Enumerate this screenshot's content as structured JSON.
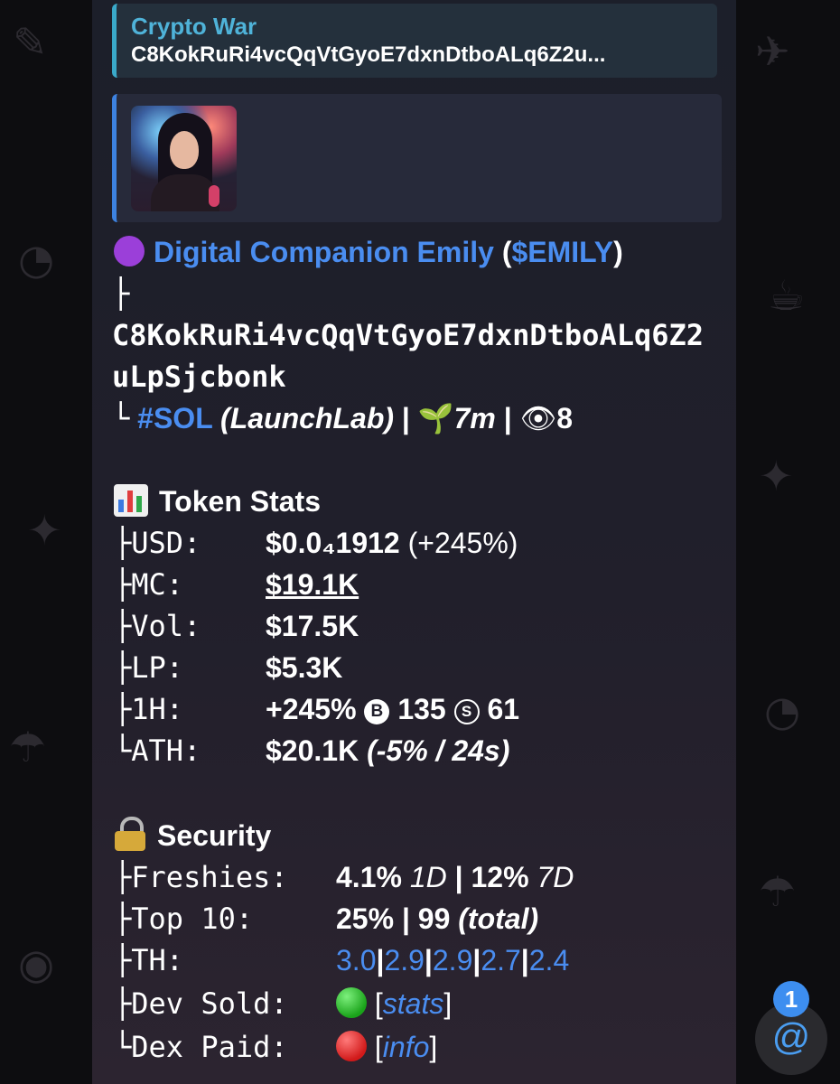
{
  "reply": {
    "title": "Crypto War",
    "text": "C8KokRuRi4vcQqVtGyoE7dxnDtboALq6Z2u..."
  },
  "token": {
    "name": "Digital Companion Emily",
    "ticker_open": "(",
    "ticker": "$EMILY",
    "ticker_close": ")",
    "tree_top": " ├",
    "address_line1": "C8KokRuRi4vcQqVtGyoE7dxnDtboALq6Z2",
    "address_line2": "uLpSjcbonk",
    "tree_bottom": " └",
    "chain": "#SOL",
    "launch": "(LaunchLab)",
    "sep": "|",
    "age_emoji": "🌱",
    "age": "7m",
    "views_emoji": "👁",
    "views": "8"
  },
  "token_stats": {
    "heading": "Token Stats",
    "usd_label": "├USD:",
    "usd_value": "$0.0₄1912",
    "usd_change": "(+245%)",
    "mc_label": "├MC:",
    "mc_value": "$19.1K",
    "vol_label": "├Vol:",
    "vol_value": "$17.5K",
    "lp_label": "├LP:",
    "lp_value": "$5.3K",
    "h1_label": "├1H:",
    "h1_change": "+245%",
    "buys_icon": "B",
    "buys": "135",
    "sells_icon": "S",
    "sells": "61",
    "ath_label": "└ATH:",
    "ath_value": "$20.1K",
    "ath_note": "(-5% / 24s)"
  },
  "security": {
    "heading": "Security",
    "freshies_label": "├Freshies:",
    "freshies_1d": "4.1%",
    "freshies_1d_unit": "1D",
    "freshies_7d": "12%",
    "freshies_7d_unit": "7D",
    "top10_label": "├Top 10:",
    "top10_pct": "25%",
    "top10_total": "99",
    "top10_note": "(total)",
    "th_label": "├TH:",
    "th_values": [
      "3.0",
      "2.9",
      "2.9",
      "2.7",
      "2.4"
    ],
    "dev_sold_label": "├Dev Sold:",
    "dev_sold_link": "stats",
    "dex_paid_label": "└Dex Paid:",
    "dex_paid_link": "info"
  },
  "mention": {
    "badge_count": "1",
    "icon": "at-icon"
  },
  "colors": {
    "link_blue": "#4a8df0",
    "reply_accent": "#3aa9c9",
    "purple": "#9b3fd9",
    "green": "#1aa31a",
    "red": "#d11a1a"
  }
}
